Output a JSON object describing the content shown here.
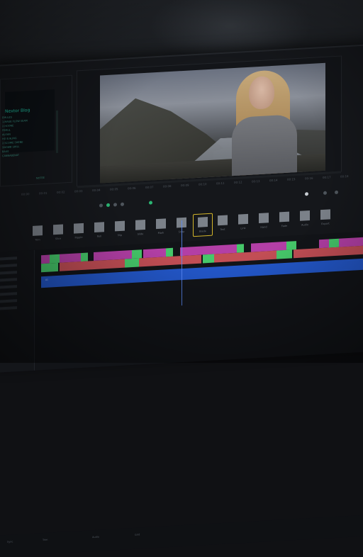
{
  "colors": {
    "accent_green": "#2bb673",
    "clip_purple": "#b33fa6",
    "clip_red": "#c24e55",
    "clip_green": "#46c86a",
    "track_blue": "#2357c9",
    "active_tool_border": "#d4b62a"
  },
  "project_panel": {
    "title": "Nextor Blog",
    "lines": [
      "EMULES",
      "1.MAGE FLOW SEAM",
      "2.HOONE",
      "FEMUL",
      "ALOAN",
      "HO B.9LING",
      "2.SCOWE SHENE",
      "SNOWB SHILL",
      "BAUE",
      "CANNABENAT"
    ],
    "status": "NOTEE"
  },
  "viewer": {
    "icon": "video-preview"
  },
  "ruler": {
    "labels": [
      "00:00",
      "00:01",
      "00:02",
      "00:03",
      "00:04",
      "00:05",
      "00:06",
      "00:07",
      "00:08",
      "00:09",
      "00:10",
      "00:11",
      "00:12",
      "00:13",
      "00:14",
      "00:15",
      "00:16",
      "00:17",
      "00:18"
    ]
  },
  "toolbar": {
    "tools": [
      {
        "label": "Trim",
        "icon": "trim-icon"
      },
      {
        "label": "Slice",
        "icon": "slice-icon"
      },
      {
        "label": "Ripple",
        "icon": "ripple-icon"
      },
      {
        "label": "Roll",
        "icon": "roll-icon"
      },
      {
        "label": "Slip",
        "icon": "slip-icon"
      },
      {
        "label": "Slide",
        "icon": "slide-icon"
      },
      {
        "label": "Mark",
        "icon": "mark-icon"
      },
      {
        "label": "Snap",
        "icon": "snap-icon"
      },
      {
        "label": "Blade",
        "icon": "blade-icon"
      },
      {
        "label": "Text",
        "icon": "text-icon"
      },
      {
        "label": "Link",
        "icon": "link-icon"
      },
      {
        "label": "Hand",
        "icon": "hand-icon"
      },
      {
        "label": "Fade",
        "icon": "fade-icon"
      },
      {
        "label": "Audio",
        "icon": "audio-icon"
      },
      {
        "label": "Export",
        "icon": "export-icon"
      }
    ],
    "active_index": 8
  },
  "timeline": {
    "blue_track_label": "A1",
    "bottom_labels": [
      "Sync",
      "Trim",
      "Audio",
      "Grid"
    ]
  }
}
